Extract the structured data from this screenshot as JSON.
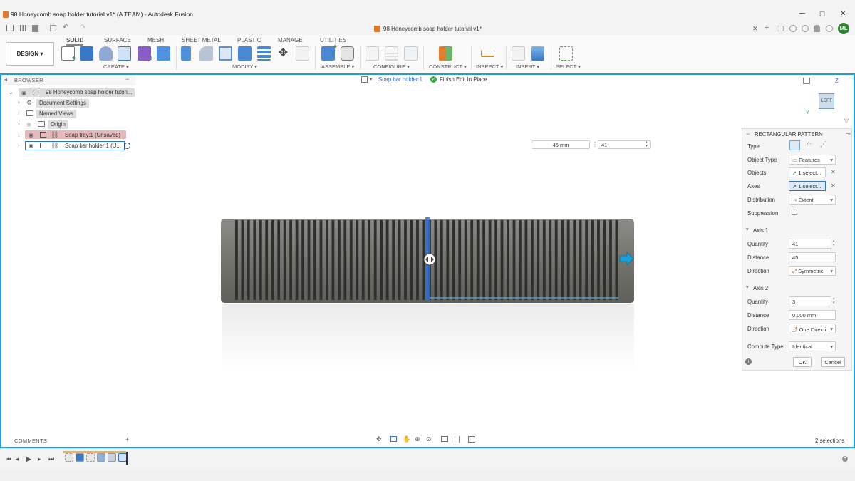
{
  "window": {
    "title": "98 Honeycomb soap holder tutorial v1* (A TEAM) - Autodesk Fusion",
    "minimize": "─",
    "maximize": "☐",
    "close": "✕"
  },
  "doc_tab": {
    "label": "98 Honeycomb soap holder tutorial v1*",
    "close": "✕"
  },
  "account_initials": "ML",
  "ribbon": {
    "workspace": "DESIGN ▾",
    "tabs": [
      "SOLID",
      "SURFACE",
      "MESH",
      "SHEET METAL",
      "PLASTIC",
      "MANAGE",
      "UTILITIES"
    ],
    "groups": [
      "CREATE ▾",
      "MODIFY ▾",
      "ASSEMBLE ▾",
      "CONFIGURE ▾",
      "CONSTRUCT ▾",
      "INSPECT ▾",
      "INSERT ▾",
      "SELECT ▾"
    ]
  },
  "browser": {
    "title": "BROWSER",
    "collapse": "−",
    "root": "98 Honeycomb soap holder tutori...",
    "items": [
      "Document Settings",
      "Named Views",
      "Origin",
      "Soap tray:1 (Unsaved)",
      "Soap bar holder:1 (U..."
    ]
  },
  "edit_context": {
    "component": "Soap bar holder:1",
    "finish": "Finish Edit In Place"
  },
  "canvas_inputs": {
    "distance": "45 mm",
    "quantity": "41"
  },
  "pattern_panel": {
    "title": "RECTANGULAR PATTERN",
    "labels": {
      "type": "Type",
      "object_type": "Object Type",
      "objects": "Objects",
      "axes": "Axes",
      "distribution": "Distribution",
      "suppression": "Suppression",
      "axis1": "Axis 1",
      "quantity1": "Quantity",
      "distance1": "Distance",
      "direction1": "Direction",
      "axis2": "Axis 2",
      "quantity2": "Quantity",
      "distance2": "Distance",
      "direction2": "Direction",
      "compute_type": "Compute Type"
    },
    "values": {
      "object_type": "Features",
      "objects": "1 select...",
      "axes": "1 select...",
      "distribution": "Extent",
      "quantity1": "41",
      "distance1": "45",
      "direction1": "Symmetric",
      "quantity2": "3",
      "distance2": "0.000 mm",
      "direction2": "One Directi...",
      "compute_type": "Identical"
    },
    "ok": "OK",
    "cancel": "Cancel"
  },
  "comments": {
    "label": "COMMENTS",
    "add": "+"
  },
  "viewcube_face": "LEFT",
  "selections": "2 selections",
  "colors": {
    "accent": "#19a0d8",
    "selection_blue": "#2f6fd1",
    "body_gray": "#6f6f6c"
  }
}
